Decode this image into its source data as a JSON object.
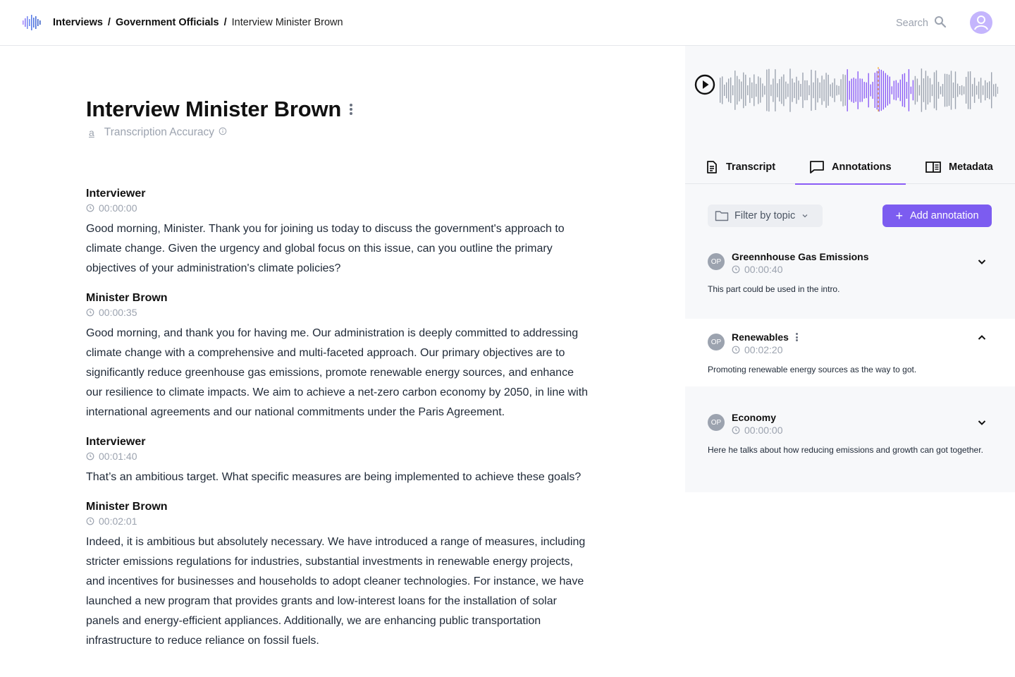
{
  "header": {
    "breadcrumb": [
      "Interviews",
      "Government Officials",
      "Interview Minister Brown"
    ],
    "separator": "/",
    "search_placeholder": "Search"
  },
  "main": {
    "title": "Interview Minister Brown",
    "accuracy_label": "Transcription Accuracy",
    "accuracy_icon": "a",
    "entries": [
      {
        "speaker": "Interviewer",
        "time": "00:00:00",
        "text": "Good morning, Minister. Thank you for joining us today to discuss the government's approach to climate change. Given the urgency and global focus on this issue, can you outline the primary objectives of your administration's climate policies?"
      },
      {
        "speaker": "Minister Brown",
        "time": "00:00:35",
        "text": "Good morning, and thank you for having me. Our administration is deeply committed to addressing climate change with a comprehensive and multi-faceted approach. Our primary objectives are to significantly reduce greenhouse gas emissions, promote renewable energy sources, and enhance our resilience to climate impacts. We aim to achieve a net-zero carbon economy by 2050, in line with international agreements and our national commitments under the Paris Agreement."
      },
      {
        "speaker": "Interviewer",
        "time": "00:01:40",
        "text": "That’s an ambitious target. What specific measures are being implemented to achieve these goals?"
      },
      {
        "speaker": "Minister Brown",
        "time": "00:02:01",
        "text": "Indeed, it is ambitious but absolutely necessary. We have introduced a range of measures, including stricter emissions regulations for industries, substantial investments in renewable energy projects, and incentives for businesses and households to adopt cleaner technologies. For instance, we have launched a new program that provides grants and low-interest loans for the installation of solar panels and energy-efficient appliances. Additionally, we are enhancing public transportation infrastructure to reduce reliance on fossil fuels."
      }
    ]
  },
  "panel": {
    "tabs": [
      {
        "label": "Transcript",
        "icon": "document-icon"
      },
      {
        "label": "Annotations",
        "icon": "comment-icon",
        "active": true
      },
      {
        "label": "Metadata",
        "icon": "book-icon"
      }
    ],
    "filter_label": "Filter by topic",
    "add_label": "Add annotation",
    "accent_color": "#7c5cf0",
    "annotations": [
      {
        "initials": "OP",
        "title": "Greennhouse Gas Emissions",
        "time": "00:00:40",
        "note": "This part could be used in the intro.",
        "expanded": false
      },
      {
        "initials": "OP",
        "title": "Renewables",
        "time": "00:02:20",
        "note": "Promoting renewable energy sources as the way to got.",
        "expanded": true
      },
      {
        "initials": "OP",
        "title": "Economy",
        "time": "00:00:00",
        "note": "Here he talks about how reducing emissions and growth can got together.",
        "expanded": false
      }
    ]
  }
}
